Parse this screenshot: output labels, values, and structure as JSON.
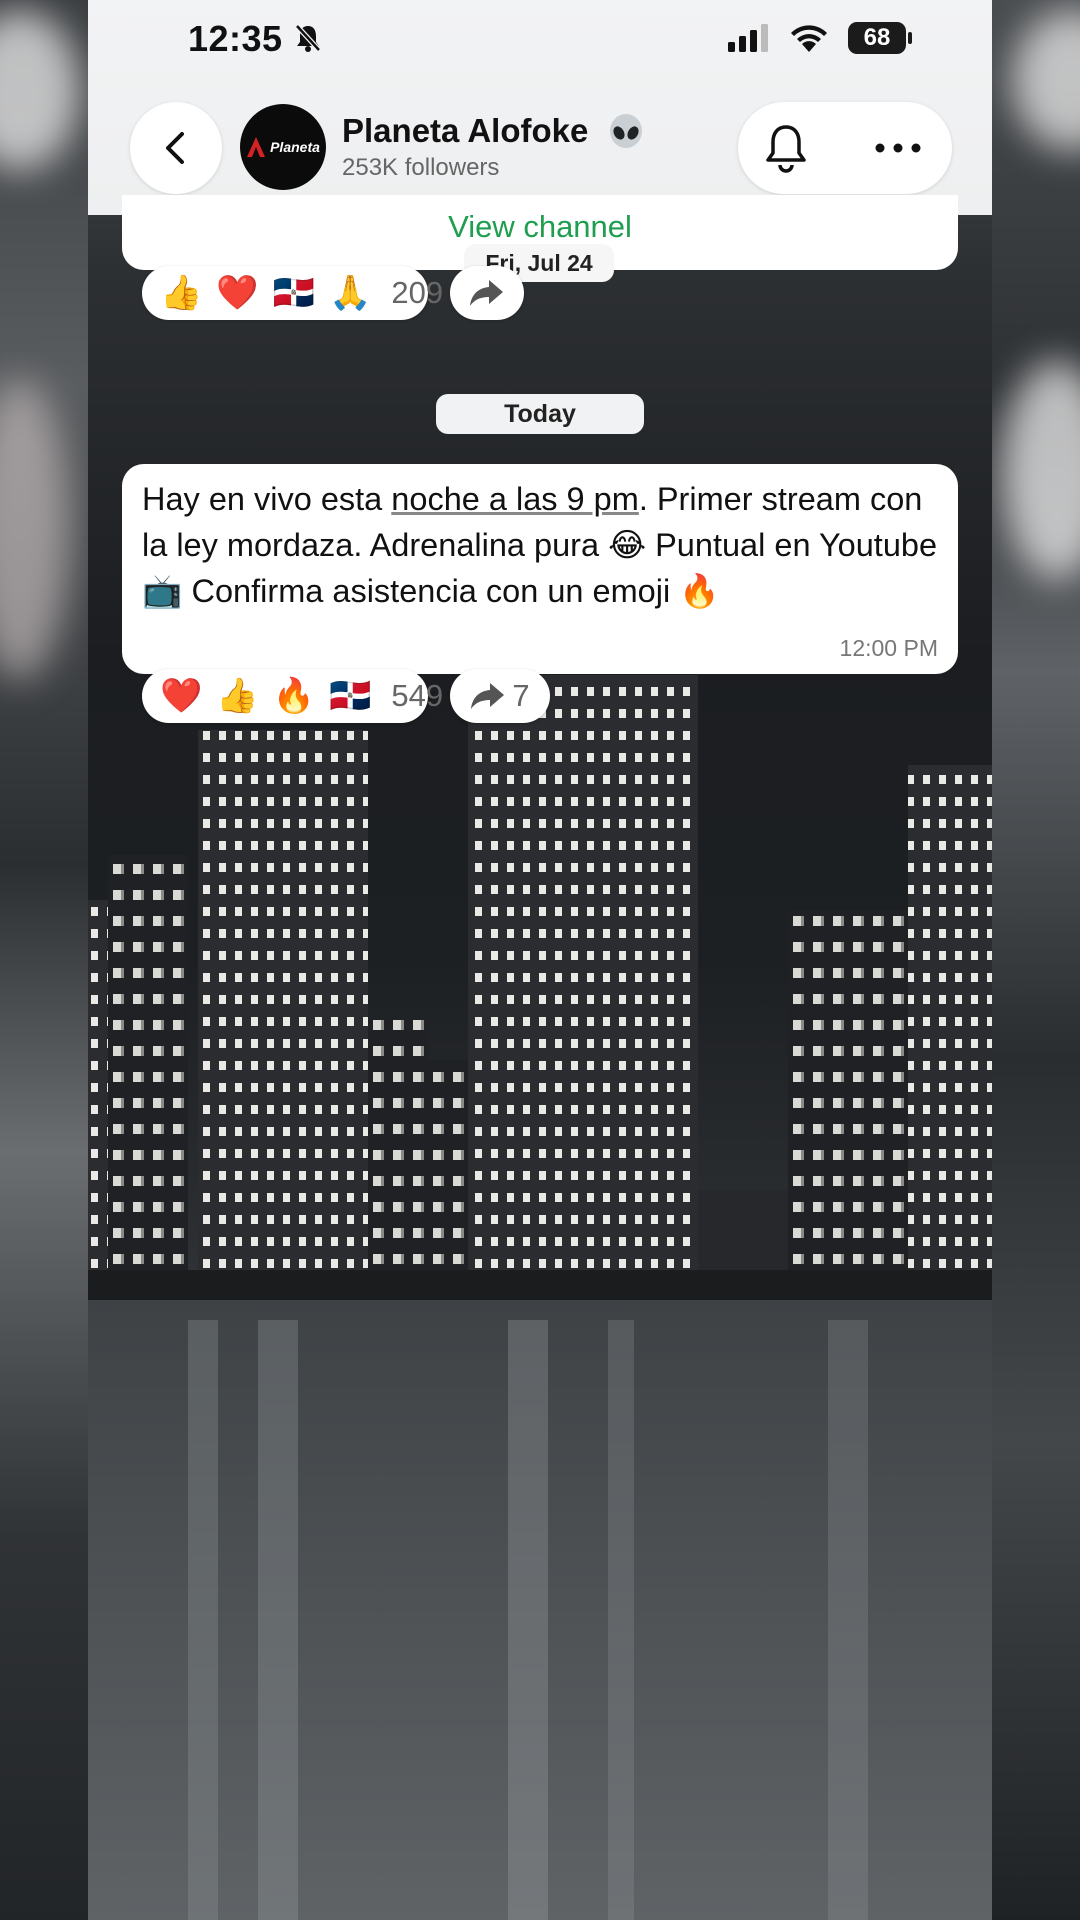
{
  "status_bar": {
    "time": "12:35",
    "battery": "68"
  },
  "header": {
    "channel_name": "Planeta Alofoke",
    "channel_emoji": "alien-emoji",
    "followers": "253K followers",
    "avatar_text": "Planeta",
    "icons": [
      "back-chevron-icon",
      "bell-icon",
      "more-icon"
    ]
  },
  "previous_message": {
    "link_label": "View channel",
    "date": "Fri, Jul 24",
    "reactions": [
      "👍",
      "❤️",
      "🇩🇴",
      "🙏"
    ],
    "reaction_count": "209"
  },
  "today_label": "Today",
  "message": {
    "text_part1": "Hay en vivo esta ",
    "text_link": "noche a las 9 pm",
    "text_part2": ". Primer stream con la ley mordaza. Adrenalina pura 😂 Puntual en Youtube 📺 Confirma asistencia con un emoji 🔥",
    "time": "12:00 PM",
    "reactions": [
      "❤️",
      "👍",
      "🔥",
      "🇩🇴"
    ],
    "reaction_count": "549",
    "forward_count": "7"
  },
  "colors": {
    "accent_green": "#1f9e4f",
    "bubble": "#ffffff",
    "header_bg": "#f2f3f4"
  }
}
